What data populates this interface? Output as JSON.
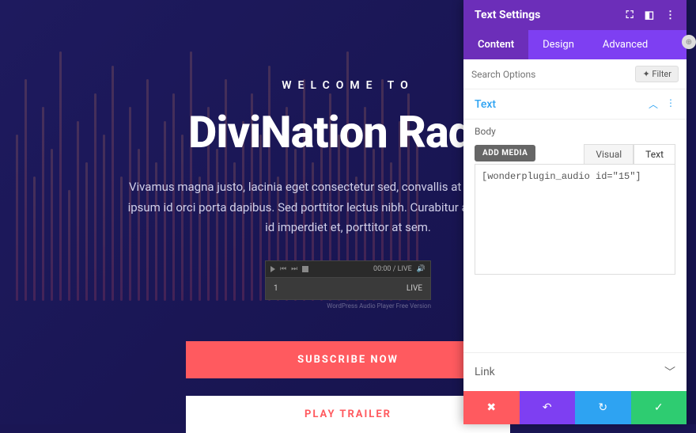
{
  "hero": {
    "welcome": "WELCOME TO",
    "title": "DiviNation Radio",
    "description": "Vivamus magna justo, lacinia eget consectetur sed, convallis at tellus. Pellentesque ipsum id orci porta dapibus. Sed porttitor lectus nibh. Curabitur arcu erat, accumsan id imperdiet et, porttitor at sem.",
    "subscribe_label": "SUBSCRIBE NOW",
    "play_label": "PLAY TRAILER"
  },
  "player": {
    "time": "00:00 / LIVE",
    "track_num": "1",
    "live_label": "LIVE",
    "caption": "WordPress Audio Player Free Version"
  },
  "panel": {
    "title": "Text Settings",
    "tabs": {
      "content": "Content",
      "design": "Design",
      "advanced": "Advanced"
    },
    "search_placeholder": "Search Options",
    "filter_label": "Filter",
    "section_text": "Text",
    "body_label": "Body",
    "add_media": "ADD MEDIA",
    "editor_tabs": {
      "visual": "Visual",
      "text": "Text"
    },
    "editor_content": "[wonderplugin_audio id=\"15\"]",
    "link_label": "Link"
  }
}
